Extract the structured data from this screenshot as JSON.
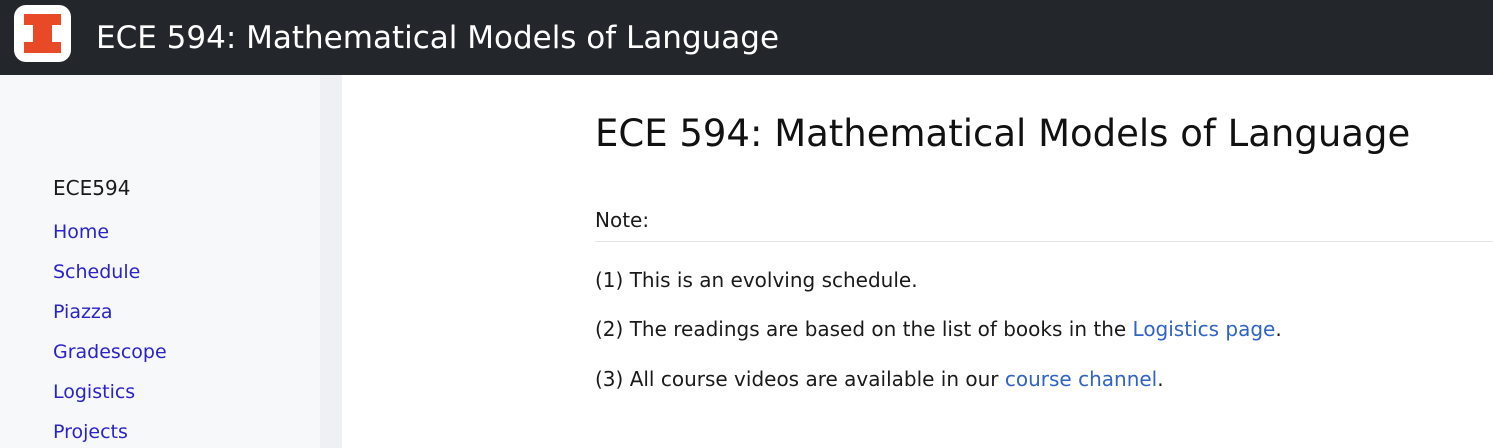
{
  "header": {
    "logo": "illinois-block-i-logo",
    "title": "ECE 594: Mathematical Models of Language"
  },
  "sidebar": {
    "site_name": "ECE594",
    "items": [
      {
        "label": "Home"
      },
      {
        "label": "Schedule"
      },
      {
        "label": "Piazza"
      },
      {
        "label": "Gradescope"
      },
      {
        "label": "Logistics"
      },
      {
        "label": "Projects"
      }
    ]
  },
  "main": {
    "title": "ECE 594: Mathematical Models of Language",
    "note_label": "Note:",
    "line1": "(1) This is an evolving schedule.",
    "line2_prefix": "(2) The readings are based on the list of books in the ",
    "line2_link": "Logistics page",
    "line2_suffix": ".",
    "line3_prefix": "(3) All course videos are available in our ",
    "line3_link": "course channel",
    "line3_suffix": "."
  },
  "colors": {
    "topbar": "#23272b",
    "logo_orange": "#e84a27",
    "nav_link": "#2a23c9",
    "content_link": "#2f63c5"
  }
}
